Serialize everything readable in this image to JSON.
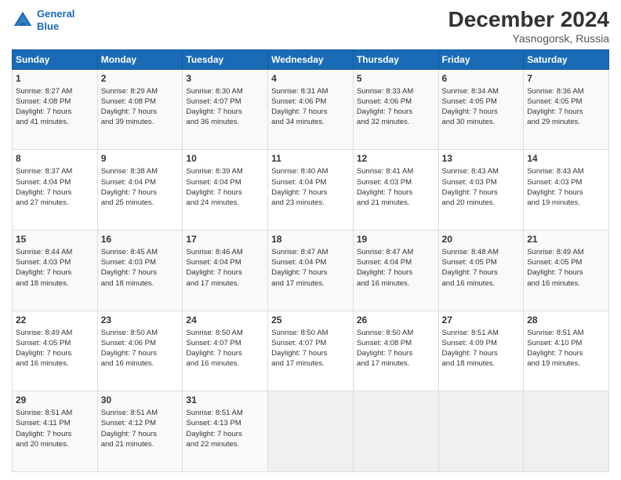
{
  "logo": {
    "line1": "General",
    "line2": "Blue"
  },
  "title": "December 2024",
  "subtitle": "Yasnogorsk, Russia",
  "weekdays": [
    "Sunday",
    "Monday",
    "Tuesday",
    "Wednesday",
    "Thursday",
    "Friday",
    "Saturday"
  ],
  "weeks": [
    [
      {
        "day": "1",
        "lines": [
          "Sunrise: 8:27 AM",
          "Sunset: 4:08 PM",
          "Daylight: 7 hours",
          "and 41 minutes."
        ]
      },
      {
        "day": "2",
        "lines": [
          "Sunrise: 8:29 AM",
          "Sunset: 4:08 PM",
          "Daylight: 7 hours",
          "and 39 minutes."
        ]
      },
      {
        "day": "3",
        "lines": [
          "Sunrise: 8:30 AM",
          "Sunset: 4:07 PM",
          "Daylight: 7 hours",
          "and 36 minutes."
        ]
      },
      {
        "day": "4",
        "lines": [
          "Sunrise: 8:31 AM",
          "Sunset: 4:06 PM",
          "Daylight: 7 hours",
          "and 34 minutes."
        ]
      },
      {
        "day": "5",
        "lines": [
          "Sunrise: 8:33 AM",
          "Sunset: 4:06 PM",
          "Daylight: 7 hours",
          "and 32 minutes."
        ]
      },
      {
        "day": "6",
        "lines": [
          "Sunrise: 8:34 AM",
          "Sunset: 4:05 PM",
          "Daylight: 7 hours",
          "and 30 minutes."
        ]
      },
      {
        "day": "7",
        "lines": [
          "Sunrise: 8:36 AM",
          "Sunset: 4:05 PM",
          "Daylight: 7 hours",
          "and 29 minutes."
        ]
      }
    ],
    [
      {
        "day": "8",
        "lines": [
          "Sunrise: 8:37 AM",
          "Sunset: 4:04 PM",
          "Daylight: 7 hours",
          "and 27 minutes."
        ]
      },
      {
        "day": "9",
        "lines": [
          "Sunrise: 8:38 AM",
          "Sunset: 4:04 PM",
          "Daylight: 7 hours",
          "and 25 minutes."
        ]
      },
      {
        "day": "10",
        "lines": [
          "Sunrise: 8:39 AM",
          "Sunset: 4:04 PM",
          "Daylight: 7 hours",
          "and 24 minutes."
        ]
      },
      {
        "day": "11",
        "lines": [
          "Sunrise: 8:40 AM",
          "Sunset: 4:04 PM",
          "Daylight: 7 hours",
          "and 23 minutes."
        ]
      },
      {
        "day": "12",
        "lines": [
          "Sunrise: 8:41 AM",
          "Sunset: 4:03 PM",
          "Daylight: 7 hours",
          "and 21 minutes."
        ]
      },
      {
        "day": "13",
        "lines": [
          "Sunrise: 8:43 AM",
          "Sunset: 4:03 PM",
          "Daylight: 7 hours",
          "and 20 minutes."
        ]
      },
      {
        "day": "14",
        "lines": [
          "Sunrise: 8:43 AM",
          "Sunset: 4:03 PM",
          "Daylight: 7 hours",
          "and 19 minutes."
        ]
      }
    ],
    [
      {
        "day": "15",
        "lines": [
          "Sunrise: 8:44 AM",
          "Sunset: 4:03 PM",
          "Daylight: 7 hours",
          "and 18 minutes."
        ]
      },
      {
        "day": "16",
        "lines": [
          "Sunrise: 8:45 AM",
          "Sunset: 4:03 PM",
          "Daylight: 7 hours",
          "and 18 minutes."
        ]
      },
      {
        "day": "17",
        "lines": [
          "Sunrise: 8:46 AM",
          "Sunset: 4:04 PM",
          "Daylight: 7 hours",
          "and 17 minutes."
        ]
      },
      {
        "day": "18",
        "lines": [
          "Sunrise: 8:47 AM",
          "Sunset: 4:04 PM",
          "Daylight: 7 hours",
          "and 17 minutes."
        ]
      },
      {
        "day": "19",
        "lines": [
          "Sunrise: 8:47 AM",
          "Sunset: 4:04 PM",
          "Daylight: 7 hours",
          "and 16 minutes."
        ]
      },
      {
        "day": "20",
        "lines": [
          "Sunrise: 8:48 AM",
          "Sunset: 4:05 PM",
          "Daylight: 7 hours",
          "and 16 minutes."
        ]
      },
      {
        "day": "21",
        "lines": [
          "Sunrise: 8:49 AM",
          "Sunset: 4:05 PM",
          "Daylight: 7 hours",
          "and 16 minutes."
        ]
      }
    ],
    [
      {
        "day": "22",
        "lines": [
          "Sunrise: 8:49 AM",
          "Sunset: 4:05 PM",
          "Daylight: 7 hours",
          "and 16 minutes."
        ]
      },
      {
        "day": "23",
        "lines": [
          "Sunrise: 8:50 AM",
          "Sunset: 4:06 PM",
          "Daylight: 7 hours",
          "and 16 minutes."
        ]
      },
      {
        "day": "24",
        "lines": [
          "Sunrise: 8:50 AM",
          "Sunset: 4:07 PM",
          "Daylight: 7 hours",
          "and 16 minutes."
        ]
      },
      {
        "day": "25",
        "lines": [
          "Sunrise: 8:50 AM",
          "Sunset: 4:07 PM",
          "Daylight: 7 hours",
          "and 17 minutes."
        ]
      },
      {
        "day": "26",
        "lines": [
          "Sunrise: 8:50 AM",
          "Sunset: 4:08 PM",
          "Daylight: 7 hours",
          "and 17 minutes."
        ]
      },
      {
        "day": "27",
        "lines": [
          "Sunrise: 8:51 AM",
          "Sunset: 4:09 PM",
          "Daylight: 7 hours",
          "and 18 minutes."
        ]
      },
      {
        "day": "28",
        "lines": [
          "Sunrise: 8:51 AM",
          "Sunset: 4:10 PM",
          "Daylight: 7 hours",
          "and 19 minutes."
        ]
      }
    ],
    [
      {
        "day": "29",
        "lines": [
          "Sunrise: 8:51 AM",
          "Sunset: 4:11 PM",
          "Daylight: 7 hours",
          "and 20 minutes."
        ]
      },
      {
        "day": "30",
        "lines": [
          "Sunrise: 8:51 AM",
          "Sunset: 4:12 PM",
          "Daylight: 7 hours",
          "and 21 minutes."
        ]
      },
      {
        "day": "31",
        "lines": [
          "Sunrise: 8:51 AM",
          "Sunset: 4:13 PM",
          "Daylight: 7 hours",
          "and 22 minutes."
        ]
      },
      null,
      null,
      null,
      null
    ]
  ]
}
